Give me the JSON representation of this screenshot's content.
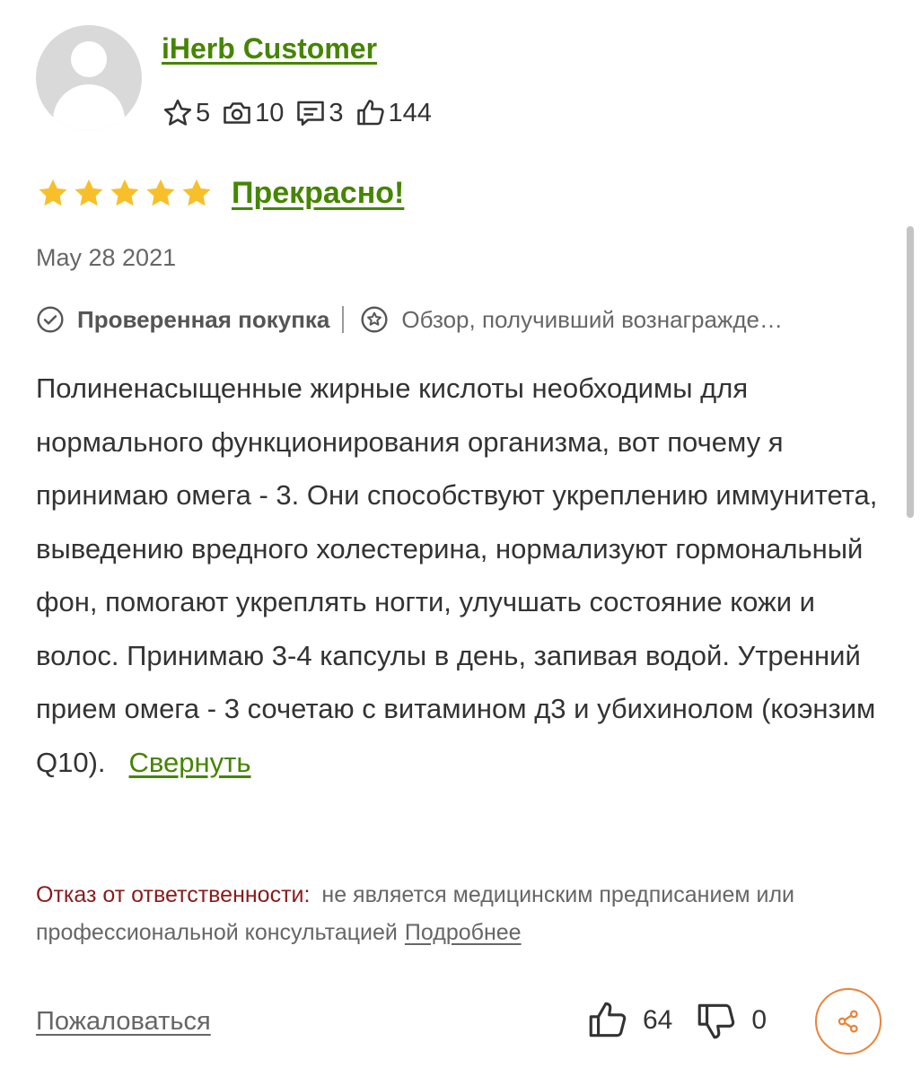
{
  "reviewer": {
    "name": "iHerb Customer",
    "stats": {
      "stars": "5",
      "photos": "10",
      "comments": "3",
      "likes": "144"
    }
  },
  "review": {
    "rating": 5,
    "rating_max": 5,
    "title": "Прекрасно!",
    "date": "May 28 2021",
    "verified_label": "Проверенная покупка",
    "reward_label": "Обзор, получивший вознагражде…",
    "text": "Полиненасыщенные жирные кислоты необходимы для нормального функционирования организма, вот почему я принимаю омега - 3. Они способствуют укреплению иммунитета, выведению вредного холестерина, нормализуют гормональный фон, помогают укреплять ногти, улучшать состояние кожи и волос. Принимаю 3-4 капсулы в день, запивая водой. Утренний прием омега - 3 сочетаю с витамином д3 и убихинолом (коэнзим Q10).",
    "collapse_label": "Свернуть"
  },
  "disclaimer": {
    "label": "Отказ от ответственности:",
    "text": "не является медицинским предписанием или профессиональной консультацией",
    "more_label": "Подробнее"
  },
  "actions": {
    "report_label": "Пожаловаться",
    "helpful_count": "64",
    "unhelpful_count": "0"
  },
  "colors": {
    "green_link": "#458500",
    "star_gold": "#f7c02a",
    "disclaimer_red": "#8b1a1a",
    "share_orange": "#e8843c"
  },
  "icons": [
    "user-avatar-icon",
    "star-outline-icon",
    "camera-icon",
    "comment-icon",
    "thumbs-up-icon",
    "star-filled-icon",
    "check-circle-icon",
    "reward-star-icon",
    "thumbs-down-icon",
    "share-icon"
  ]
}
